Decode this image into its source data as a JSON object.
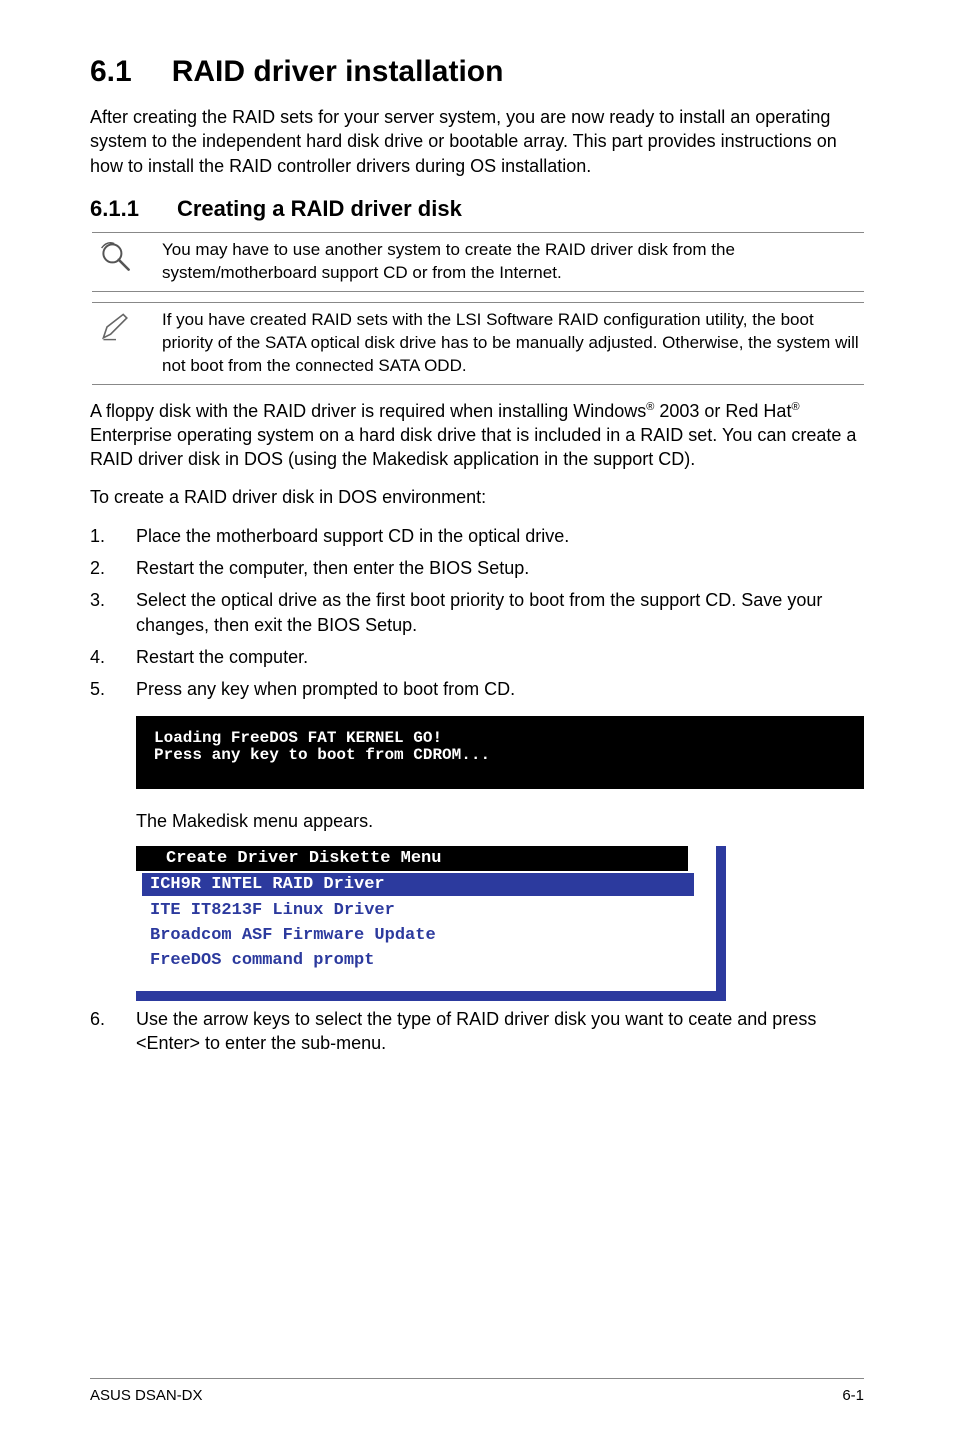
{
  "heading": {
    "num": "6.1",
    "title": "RAID driver installation"
  },
  "intro": "After creating the RAID sets for your server system, you are now ready to install an operating system to the independent hard disk drive or bootable array. This part provides instructions on how to install the RAID controller drivers during OS installation.",
  "subheading": {
    "num": "6.1.1",
    "title": "Creating a RAID driver disk"
  },
  "note1": "You may have to use another system to create the RAID driver disk from the system/motherboard support CD or from the Internet.",
  "note2": "If you have created RAID sets with the LSI Software RAID configuration utility, the boot priority of the SATA optical disk drive has to be manually adjusted. Otherwise, the system will not boot from the connected SATA ODD.",
  "para1_pre": "A floppy disk with the RAID driver is required when installing Windows",
  "para1_sup1": "®",
  "para1_mid": " 2003 or Red Hat",
  "para1_sup2": "®",
  "para1_post": " Enterprise operating system on a hard disk drive that is included in a RAID set. You can create a RAID driver disk in DOS (using the Makedisk application in the support CD).",
  "para2": "To create a RAID driver disk in DOS environment:",
  "steps": {
    "s1": "Place the motherboard support CD in the optical drive.",
    "s2": "Restart the computer, then enter the BIOS Setup.",
    "s3": "Select the optical drive as the first boot priority to boot from the support CD. Save your changes, then exit the BIOS Setup.",
    "s4": "Restart the computer.",
    "s5": "Press any key when prompted to boot from CD."
  },
  "terminal": {
    "line1": "Loading FreeDOS FAT KERNEL GO!",
    "line2": "Press any key to boot from CDROM..."
  },
  "followup": "The Makedisk menu appears.",
  "menu": {
    "header": "Create Driver Diskette Menu",
    "selected": "ICH9R INTEL RAID Driver",
    "item1": "ITE IT8213F Linux Driver",
    "item2": "Broadcom ASF Firmware Update",
    "item3": "FreeDOS command prompt"
  },
  "step6": "Use the arrow keys to select the type of RAID driver disk you want to ceate and press <Enter> to enter the sub-menu.",
  "footer": {
    "left": "ASUS DSAN-DX",
    "right": "6-1"
  }
}
